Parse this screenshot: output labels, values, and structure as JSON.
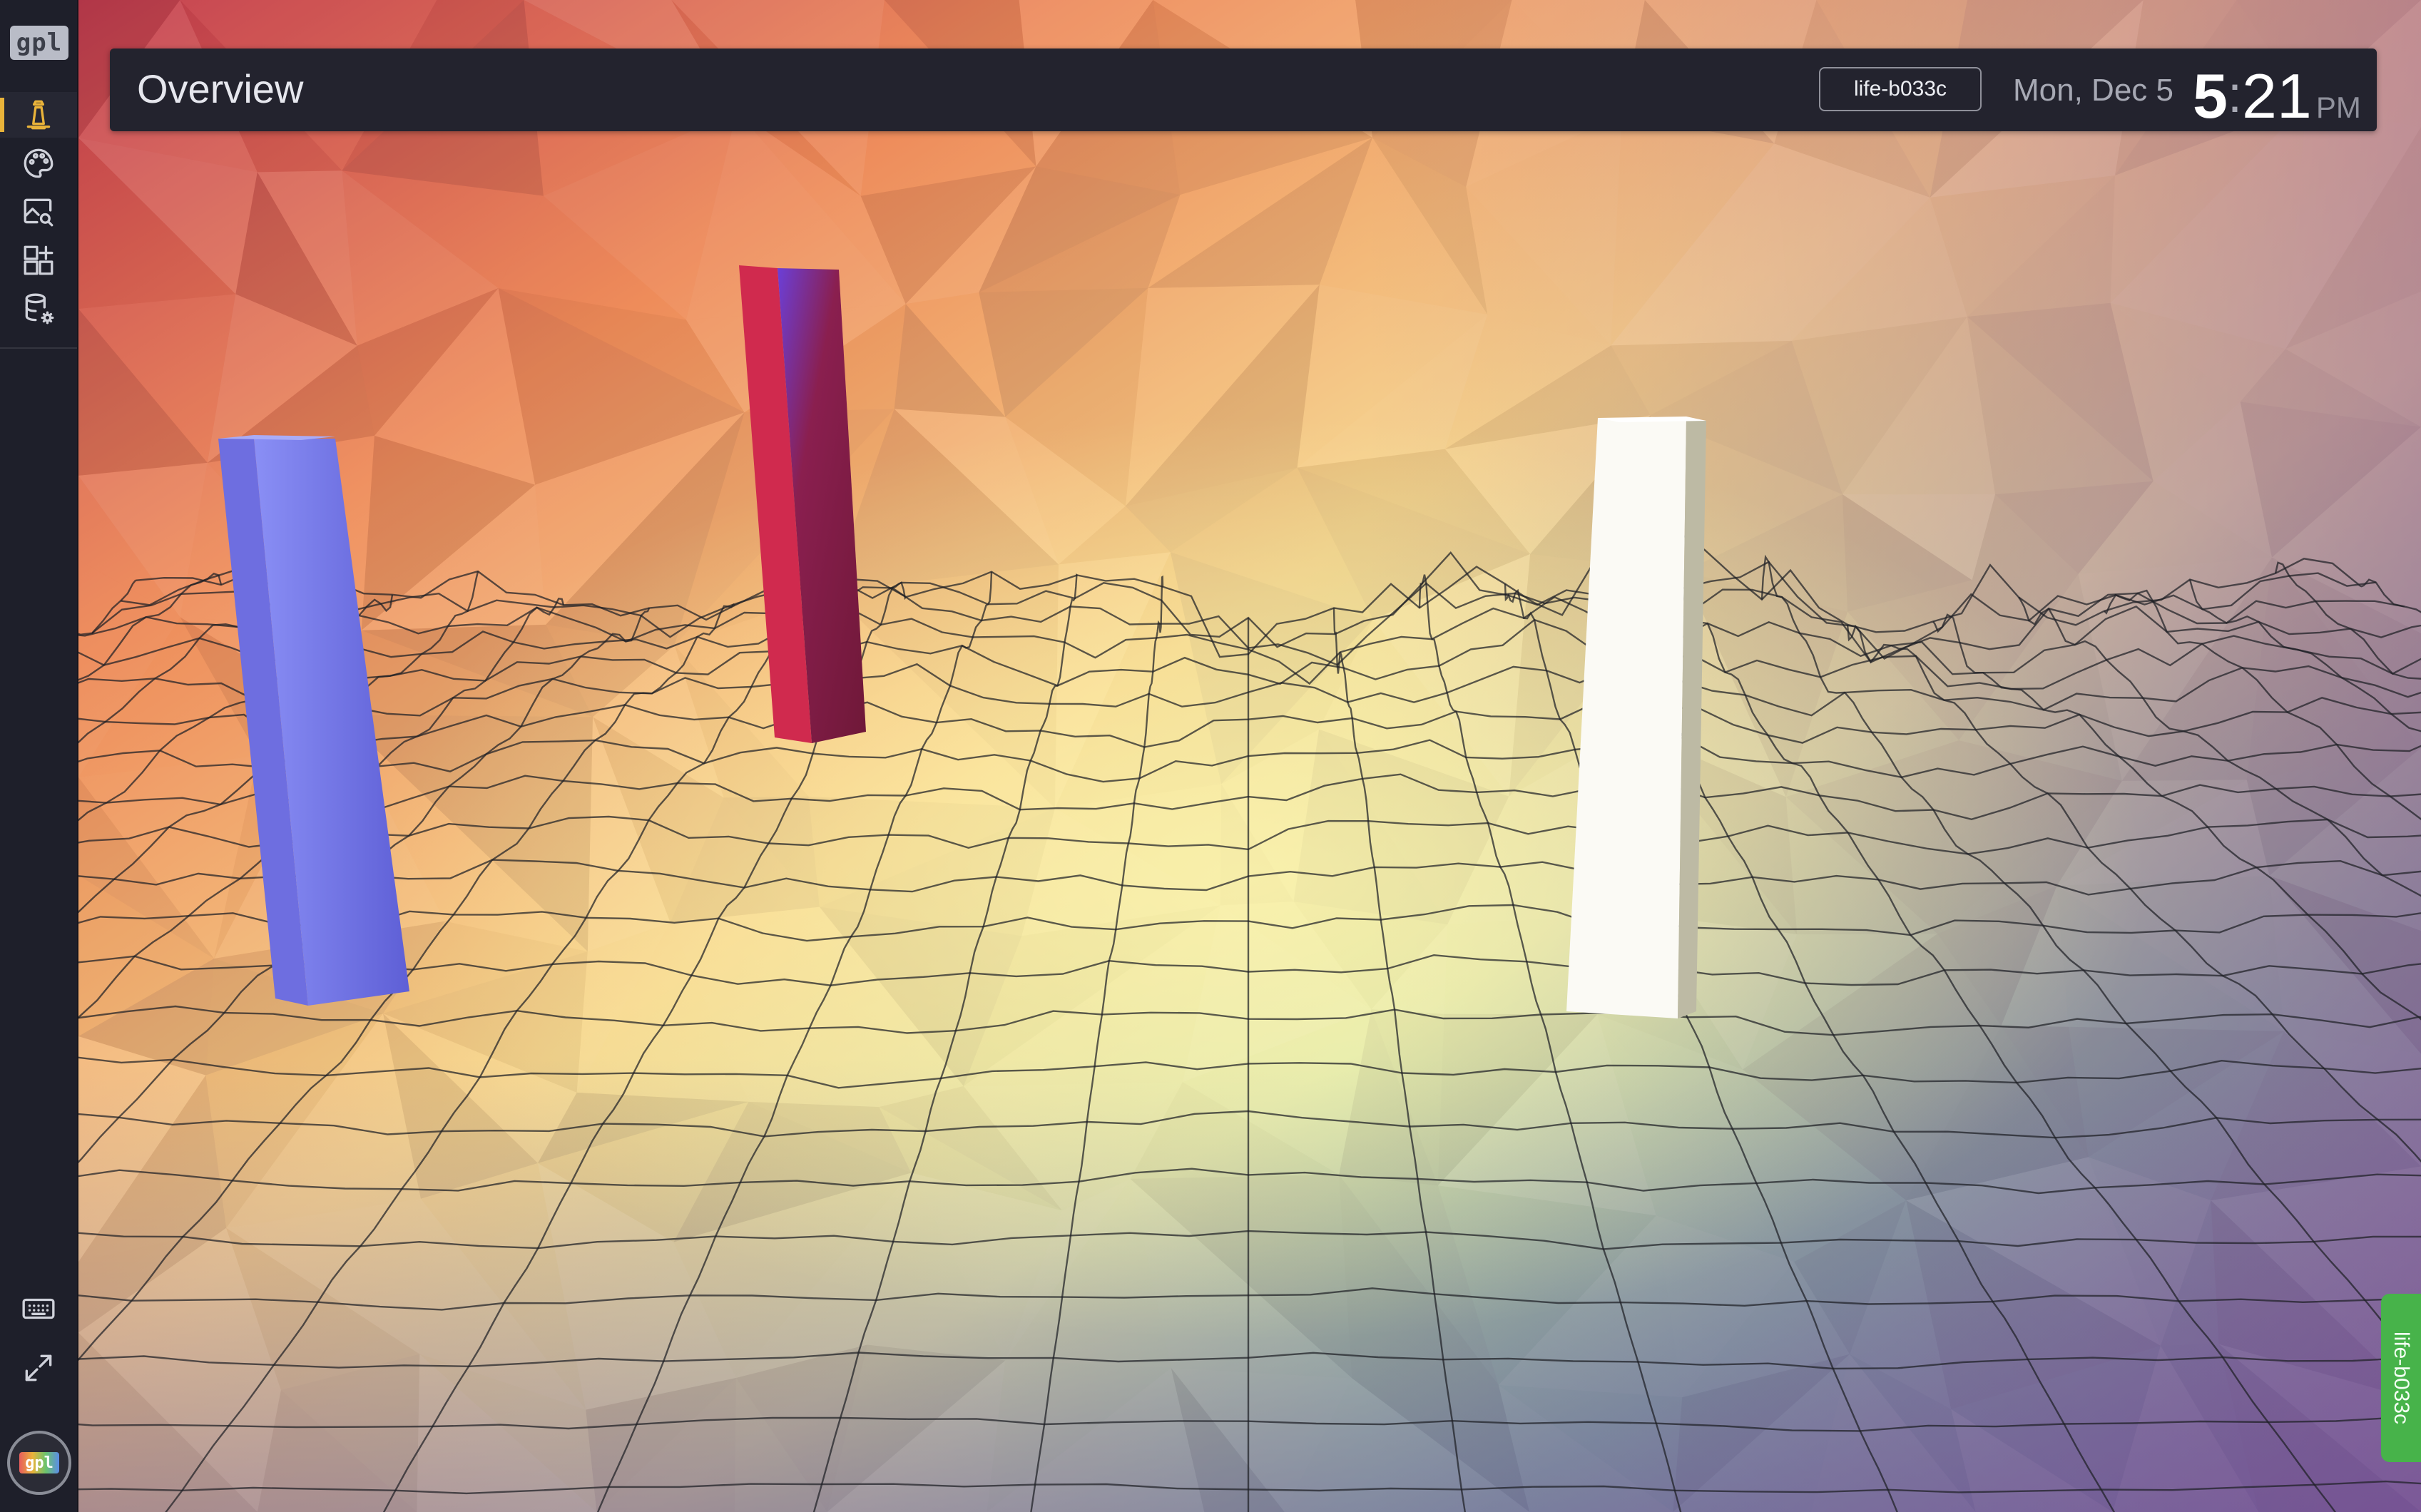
{
  "app": {
    "logo_text": "gpl",
    "avatar_text": "gpl"
  },
  "sidebar": {
    "items": [
      {
        "name": "overview",
        "icon": "lighthouse-icon",
        "active": true
      },
      {
        "name": "themes",
        "icon": "palette-icon",
        "active": false
      },
      {
        "name": "images",
        "icon": "image-search-icon",
        "active": false
      },
      {
        "name": "layouts",
        "icon": "grid-add-icon",
        "active": false
      },
      {
        "name": "data-settings",
        "icon": "database-gear-icon",
        "active": false
      }
    ],
    "bottom_items": [
      {
        "name": "keyboard",
        "icon": "keyboard-icon"
      },
      {
        "name": "fullscreen",
        "icon": "expand-icon"
      }
    ]
  },
  "header": {
    "title": "Overview",
    "host": "life-b033c",
    "date": "Mon, Dec 5",
    "time_hour": "5",
    "time_separator": ":",
    "time_minutes": "21",
    "time_ampm": "PM"
  },
  "side_tab": {
    "label": "life-b033c",
    "color": "#47b34a"
  },
  "theme": {
    "accent": "#e9b33a",
    "sidebar_bg": "#1e1f2a",
    "header_bg": "#23232e"
  },
  "scene": {
    "pillars": [
      {
        "name": "blue-pillar",
        "color": "#7b7ff0"
      },
      {
        "name": "crimson-pillar",
        "color": "#c22450"
      },
      {
        "name": "white-pillar",
        "color": "#f4f3ee"
      }
    ]
  }
}
